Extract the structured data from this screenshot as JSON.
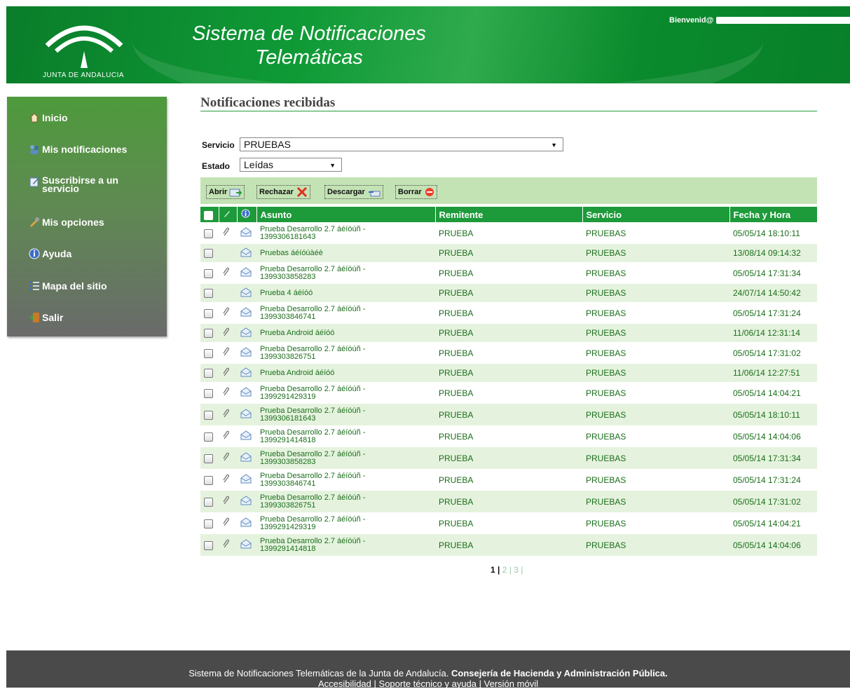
{
  "header": {
    "logo_text": "JUNTA DE ANDALUCIA",
    "title_line1": "Sistema de Notificaciones",
    "title_line2": "Telemáticas",
    "welcome": "Bienvenid@"
  },
  "sidebar": {
    "items": [
      {
        "label": "Inicio",
        "icon": "home-icon"
      },
      {
        "label": "Mis notificaciones",
        "icon": "people-icon"
      },
      {
        "label": "Suscribirse a un servicio",
        "icon": "edit-icon"
      },
      {
        "label": "Mis opciones",
        "icon": "tools-icon"
      },
      {
        "label": "Ayuda",
        "icon": "info-icon"
      },
      {
        "label": "Mapa del sitio",
        "icon": "list-icon"
      },
      {
        "label": "Salir",
        "icon": "exit-door-icon"
      }
    ]
  },
  "main": {
    "heading": "Notificaciones recibidas",
    "filters": {
      "servicio_label": "Servicio",
      "servicio_value": "PRUEBAS",
      "estado_label": "Estado",
      "estado_value": "Leídas"
    },
    "toolbar": {
      "abrir": "Abrir",
      "rechazar": "Rechazar",
      "descargar": "Descargar",
      "borrar": "Borrar"
    },
    "table": {
      "columns": [
        "Asunto",
        "Remitente",
        "Servicio",
        "Fecha y Hora"
      ],
      "rows": [
        {
          "l1": "Prueba Desarrollo 2.7 áéíóúñ -",
          "l2": "1399306181643",
          "clip": true,
          "remitente": "PRUEBA",
          "servicio": "PRUEBAS",
          "fecha": "05/05/14 18:10:11"
        },
        {
          "l1": "Pruebas áéíóúàéè",
          "l2": "",
          "clip": false,
          "remitente": "PRUEBA",
          "servicio": "PRUEBAS",
          "fecha": "13/08/14 09:14:32"
        },
        {
          "l1": "Prueba Desarrollo 2.7 áéíóúñ -",
          "l2": "1399303858283",
          "clip": true,
          "remitente": "PRUEBA",
          "servicio": "PRUEBAS",
          "fecha": "05/05/14 17:31:34"
        },
        {
          "l1": "Prueba 4 áéíóó",
          "l2": "",
          "clip": false,
          "remitente": "PRUEBA",
          "servicio": "PRUEBAS",
          "fecha": "24/07/14 14:50:42"
        },
        {
          "l1": "Prueba Desarrollo 2.7 áéíóúñ -",
          "l2": "1399303846741",
          "clip": true,
          "remitente": "PRUEBA",
          "servicio": "PRUEBAS",
          "fecha": "05/05/14 17:31:24"
        },
        {
          "l1": "Prueba Android áéíóó",
          "l2": "",
          "clip": true,
          "remitente": "PRUEBA",
          "servicio": "PRUEBAS",
          "fecha": "11/06/14 12:31:14"
        },
        {
          "l1": "Prueba Desarrollo 2.7 áéíóúñ -",
          "l2": "1399303826751",
          "clip": true,
          "remitente": "PRUEBA",
          "servicio": "PRUEBAS",
          "fecha": "05/05/14 17:31:02"
        },
        {
          "l1": "Prueba Android áéíóó",
          "l2": "",
          "clip": true,
          "remitente": "PRUEBA",
          "servicio": "PRUEBAS",
          "fecha": "11/06/14 12:27:51"
        },
        {
          "l1": "Prueba Desarrollo 2.7 áéíóúñ -",
          "l2": "1399291429319",
          "clip": true,
          "remitente": "PRUEBA",
          "servicio": "PRUEBAS",
          "fecha": "05/05/14 14:04:21"
        },
        {
          "l1": "Prueba Desarrollo 2.7 áéíóúñ -",
          "l2": "1399306181643",
          "clip": true,
          "remitente": "PRUEBA",
          "servicio": "PRUEBAS",
          "fecha": "05/05/14 18:10:11"
        },
        {
          "l1": "Prueba Desarrollo 2.7 áéíóúñ -",
          "l2": "1399291414818",
          "clip": true,
          "remitente": "PRUEBA",
          "servicio": "PRUEBAS",
          "fecha": "05/05/14 14:04:06"
        },
        {
          "l1": "Prueba Desarrollo 2.7 áéíóúñ -",
          "l2": "1399303858283",
          "clip": true,
          "remitente": "PRUEBA",
          "servicio": "PRUEBAS",
          "fecha": "05/05/14 17:31:34"
        },
        {
          "l1": "Prueba Desarrollo 2.7 áéíóúñ -",
          "l2": "1399303846741",
          "clip": true,
          "remitente": "PRUEBA",
          "servicio": "PRUEBAS",
          "fecha": "05/05/14 17:31:24"
        },
        {
          "l1": "Prueba Desarrollo 2.7 áéíóúñ -",
          "l2": "1399303826751",
          "clip": true,
          "remitente": "PRUEBA",
          "servicio": "PRUEBAS",
          "fecha": "05/05/14 17:31:02"
        },
        {
          "l1": "Prueba Desarrollo 2.7 áéíóúñ -",
          "l2": "1399291429319",
          "clip": true,
          "remitente": "PRUEBA",
          "servicio": "PRUEBAS",
          "fecha": "05/05/14 14:04:21"
        },
        {
          "l1": "Prueba Desarrollo 2.7 áéíóúñ -",
          "l2": "1399291414818",
          "clip": true,
          "remitente": "PRUEBA",
          "servicio": "PRUEBAS",
          "fecha": "05/05/14 14:04:06"
        }
      ]
    },
    "pager": {
      "current": "1",
      "sep": "|",
      "p2": "2",
      "p3": "3"
    }
  },
  "footer": {
    "line1_a": "Sistema de Notificaciones Telemáticas de la Junta de Andalucía.",
    "line1_b": "Consejería de Hacienda y Administración Pública",
    "line1_c": ".",
    "accesibilidad": "Accesibilidad",
    "soporte": "Soporte técnico y ayuda",
    "movil": "Versión móvil",
    "sep": "|"
  },
  "colors": {
    "header_green": "#0f9a36",
    "table_header_green": "#1d9a3a",
    "row_alt": "#e5f3de",
    "toolbar_bg": "#c4e3b5",
    "footer_bg": "#4a4a4a"
  }
}
